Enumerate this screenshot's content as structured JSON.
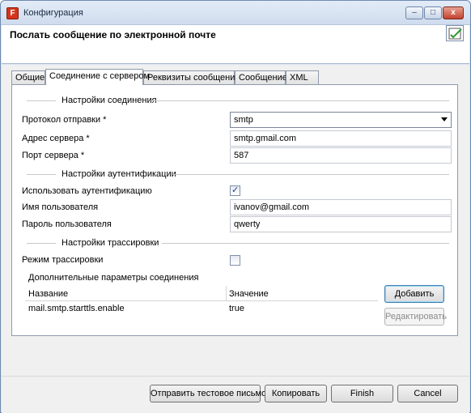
{
  "window": {
    "title": "Конфигурация",
    "app_icon_letter": "F",
    "controls": {
      "minimize": "–",
      "maximize": "□",
      "close": "x"
    }
  },
  "header": {
    "title": "Послать сообщение по электронной почте",
    "icon": "checkmark-document-icon"
  },
  "tabs": [
    {
      "label": "Общие",
      "active": false
    },
    {
      "label": "Соединение с сервером",
      "active": true
    },
    {
      "label": "Реквизиты сообщения",
      "active": false
    },
    {
      "label": "Сообщение",
      "active": false
    },
    {
      "label": "XML",
      "active": false
    }
  ],
  "connection": {
    "section_title": "Настройки соединения",
    "protocol_label": "Протокол отправки *",
    "protocol_value": "smtp",
    "server_label": "Адрес сервера *",
    "server_value": "smtp.gmail.com",
    "port_label": "Порт сервера *",
    "port_value": "587"
  },
  "auth": {
    "section_title": "Настройки аутентификации",
    "use_auth_label": "Использовать аутентификацию",
    "use_auth_checked": true,
    "username_label": "Имя пользователя",
    "username_value": "ivanov@gmail.com",
    "password_label": "Пароль пользователя",
    "password_value": "qwerty"
  },
  "trace": {
    "section_title": "Настройки трассировки",
    "trace_mode_label": "Режим трассировки",
    "trace_mode_checked": false
  },
  "params": {
    "title": "Дополнительные параметры соединения",
    "columns": {
      "name": "Название",
      "value": "Значение"
    },
    "rows": [
      {
        "name": "mail.smtp.starttls.enable",
        "value": "true"
      }
    ],
    "add_button": "Добавить",
    "edit_button": "Редактировать"
  },
  "footer": {
    "send_test": "Отправить тестовое письмо",
    "copy": "Копировать",
    "finish": "Finish",
    "cancel": "Cancel"
  },
  "colors": {
    "titlebar": "#cfdcee",
    "window_frame": "#6f8bb0",
    "close_button": "#c2412d",
    "default_button_border": "#3c7fb1"
  }
}
